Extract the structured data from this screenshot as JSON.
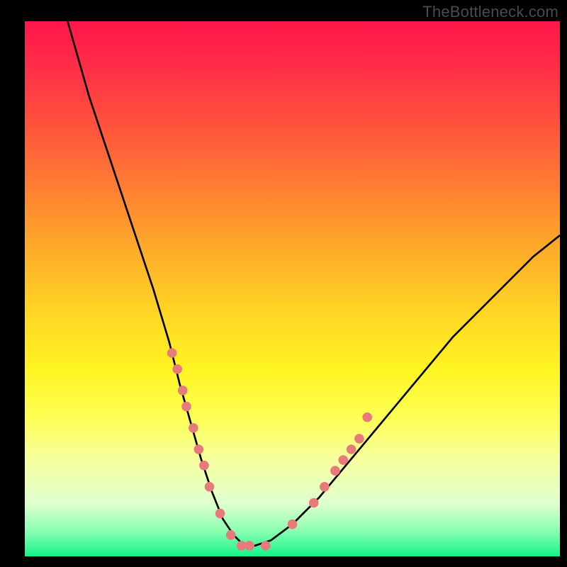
{
  "watermark": "TheBottleneck.com",
  "colors": {
    "frame_bg": "#000000",
    "curve": "#000000",
    "markers": "#e77b7b",
    "gradient_top": "#ff1749",
    "gradient_bottom": "#14f58a"
  },
  "chart_data": {
    "type": "line",
    "title": "",
    "xlabel": "",
    "ylabel": "",
    "xlim": [
      0,
      100
    ],
    "ylim": [
      0,
      100
    ],
    "grid": false,
    "legend": false,
    "series": [
      {
        "name": "curve",
        "x": [
          8,
          10,
          12,
          15,
          18,
          21,
          24,
          27,
          29,
          31,
          33,
          35,
          37,
          39,
          41,
          43,
          46,
          50,
          55,
          60,
          65,
          70,
          75,
          80,
          85,
          90,
          95,
          100
        ],
        "y": [
          100,
          93,
          86,
          77,
          68,
          59,
          50,
          40,
          32,
          25,
          18,
          12,
          7,
          4,
          2,
          2,
          3,
          6,
          11,
          17,
          23,
          29,
          35,
          41,
          46,
          51,
          56,
          60
        ]
      }
    ],
    "markers": {
      "name": "highlight-points",
      "x": [
        27.5,
        28.5,
        29.5,
        30.2,
        31.5,
        32.5,
        33.5,
        34.5,
        36.5,
        38.5,
        40.5,
        42.0,
        45.0,
        50.0,
        54.0,
        56.0,
        58.0,
        59.5,
        61.0,
        62.5,
        64.0
      ],
      "y": [
        38,
        35,
        31,
        28,
        24,
        20,
        17,
        13,
        8,
        4,
        2,
        2,
        2,
        6,
        10,
        13,
        16,
        18,
        20,
        22,
        26
      ]
    }
  }
}
